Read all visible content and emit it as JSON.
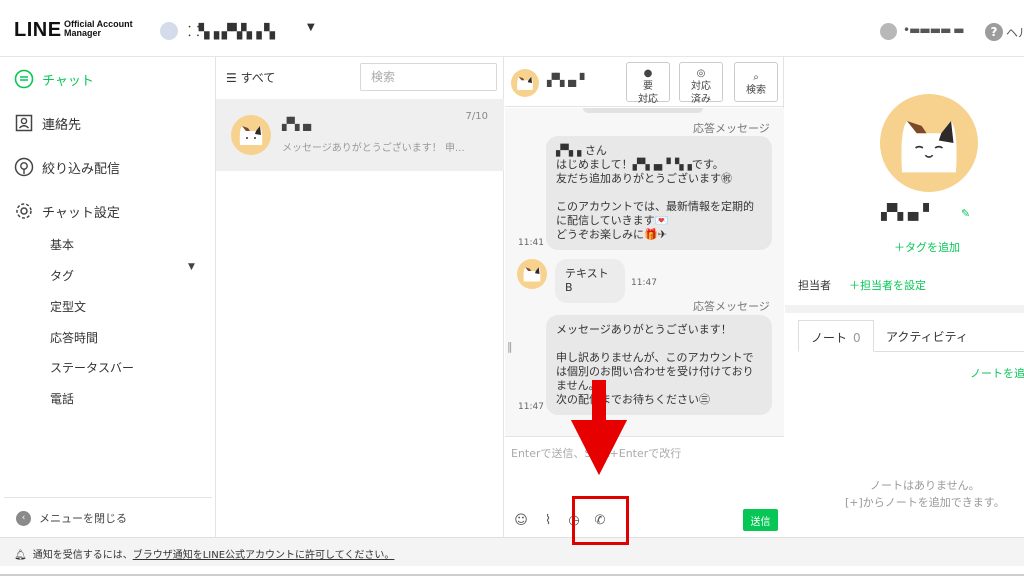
{
  "header": {
    "logo": "LINE",
    "logo_sub": "Official Account Manager",
    "account_name": "⸬▚▗ ▞▚▚▗ ▚",
    "user_name": "•▬▬▬▬ ▬",
    "help_label": "ヘル"
  },
  "sidebar": {
    "items": [
      {
        "label": "チャット"
      },
      {
        "label": "連絡先"
      },
      {
        "label": "絞り込み配信"
      },
      {
        "label": "チャット設定"
      }
    ],
    "subitems": [
      "基本",
      "タグ",
      "定型文",
      "応答時間",
      "ステータスバー",
      "電話"
    ],
    "close_menu": "メニューを閉じる"
  },
  "chatlist": {
    "filter_label": "すべて",
    "search_placeholder": "検索",
    "rows": [
      {
        "name": "▞▚▗▖",
        "date": "7/10",
        "preview": "メッセージありがとうございます！ 申..."
      }
    ]
  },
  "conversation": {
    "contact_name": "▞▚▗▖▘",
    "buttons": [
      {
        "icon": "●",
        "label": "要\n対応"
      },
      {
        "icon": "◎",
        "label": "対応\n済み"
      },
      {
        "icon": "⌕",
        "label": "検索"
      }
    ],
    "messages": [
      {
        "label": "応答メッセージ",
        "text": "▞▚▗ さん\nはじめまして！▞▚▗▖▘▚▗です。\n友だち追加ありがとうございます㊗\n\nこのアカウントでは、最新情報を定期的\nに配信していきます💌\nどうぞお楽しみに🎁✈",
        "time": "11:41"
      },
      {
        "text": "テキストB",
        "time": "11:47"
      },
      {
        "label": "応答メッセージ",
        "text": "メッセージありがとうございます！\n\n申し訳ありませんが、このアカウントで\nは個別のお問い合わせを受け付けており\nません。\n次の配信までお待ちください㊂",
        "time": "11:47"
      }
    ],
    "compose_placeholder": "Enterで送信、Shift+Enterで改行",
    "send_label": "送信"
  },
  "profile": {
    "name": "▞▚▗▖▘",
    "add_tag": "＋タグを追加",
    "assignee_label": "担当者",
    "assignee_link": "＋担当者を設定",
    "tabs": [
      {
        "label": "ノート",
        "count": "0"
      },
      {
        "label": "アクティビティ"
      }
    ],
    "add_note": "ノートを追",
    "empty_line1": "ノートはありません。",
    "empty_line2": "[+]からノートを追加できます。"
  },
  "notice": {
    "prefix": "通知を受信するには、",
    "link": "ブラウザ通知をLINE公式アカウントに許可してください。"
  },
  "colors": {
    "accent": "#06c755",
    "annotation": "#e60000",
    "avatar_bg": "#f6d28e"
  }
}
